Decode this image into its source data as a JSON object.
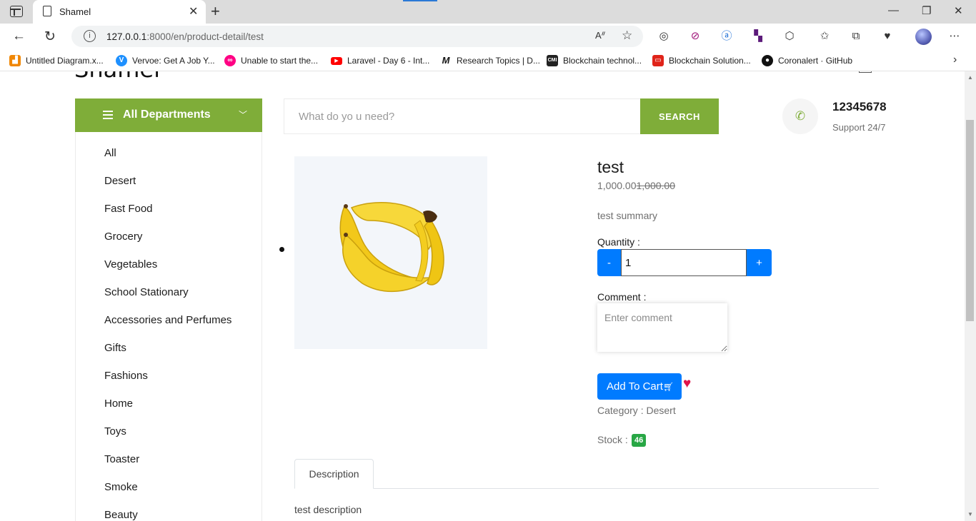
{
  "browser": {
    "tab_title": "Shamel",
    "url_host": "127.0.0.1",
    "url_rest": ":8000/en/product-detail/test",
    "bookmarks": [
      {
        "label": "Untitled Diagram.x...",
        "icon": "drawio-icon",
        "color": "#f08705"
      },
      {
        "label": "Vervoe: Get A Job Y...",
        "icon": "vervoe-icon",
        "color": "#1e90ff"
      },
      {
        "label": "Unable to start the...",
        "icon": "flickr-icon",
        "color": "#ff0084"
      },
      {
        "label": "Laravel - Day 6 - Int...",
        "icon": "youtube-icon",
        "color": "#ff0000"
      },
      {
        "label": "Research Topics | D...",
        "icon": "m-icon",
        "color": "#111111"
      },
      {
        "label": "Blockchain technol...",
        "icon": "cmi-icon",
        "color": "#222222"
      },
      {
        "label": "Blockchain Solution...",
        "icon": "oracle-icon",
        "color": "#e0241a"
      },
      {
        "label": "Coronalert · GitHub",
        "icon": "github-icon",
        "color": "#111111"
      }
    ]
  },
  "site": {
    "logo": "Shamel",
    "departments_title": "All Departments",
    "departments": [
      "All",
      "Desert",
      "Fast Food",
      "Grocery",
      "Vegetables",
      "School Stationary",
      "Accessories and Perfumes",
      "Gifts",
      "Fashions",
      "Home",
      "Toys",
      "Toaster",
      "Smoke",
      "Beauty"
    ],
    "search_placeholder": "What do yo u need?",
    "search_button": "SEARCH",
    "phone": "12345678",
    "support": "Support 24/7"
  },
  "product": {
    "name": "test",
    "price": "1,000.00",
    "old_price": "1,000.00",
    "summary": "test summary",
    "quantity_label": "Quantity :",
    "minus_label": "-",
    "plus_label": "+",
    "quantity_value": "1",
    "comment_label": "Comment :",
    "comment_placeholder": "Enter comment",
    "add_to_cart": "Add To Cart",
    "category_text": "Category : Desert",
    "stock_label": "Stock :",
    "stock_count": "46",
    "tab_description": "Description",
    "description": "test description"
  },
  "colors": {
    "brand_green": "#7fad39",
    "button_blue": "#007bff",
    "heart_red": "#e0154a",
    "badge_green": "#28a745"
  }
}
